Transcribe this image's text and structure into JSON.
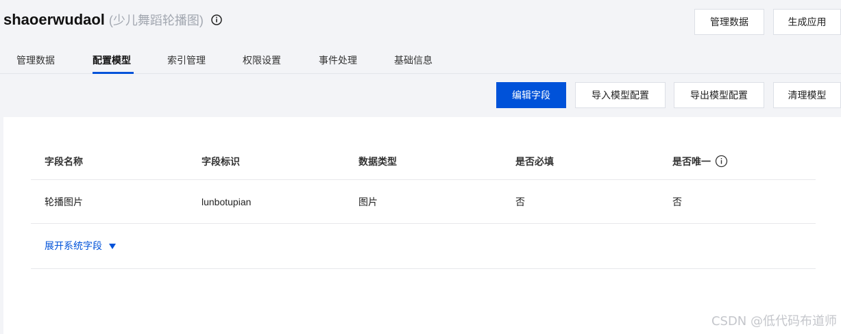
{
  "app": {
    "name": "shaoerwudaol",
    "description": "(少儿舞蹈轮播图)"
  },
  "header_buttons": {
    "manage_data": "管理数据",
    "generate_app": "生成应用"
  },
  "tabs": [
    {
      "label": "管理数据",
      "active": false
    },
    {
      "label": "配置模型",
      "active": true
    },
    {
      "label": "索引管理",
      "active": false
    },
    {
      "label": "权限设置",
      "active": false
    },
    {
      "label": "事件处理",
      "active": false
    },
    {
      "label": "基础信息",
      "active": false
    }
  ],
  "toolbar": {
    "edit_fields": "编辑字段",
    "import_config": "导入模型配置",
    "export_config": "导出模型配置",
    "clear_model": "清理模型"
  },
  "table": {
    "columns": [
      "字段名称",
      "字段标识",
      "数据类型",
      "是否必填",
      "是否唯一"
    ],
    "rows": [
      [
        "轮播图片",
        "lunbotupian",
        "图片",
        "否",
        "否"
      ]
    ]
  },
  "expand_system_fields": "展开系统字段",
  "watermark": "CSDN @低代码布道师",
  "colors": {
    "primary": "#0052d9",
    "background": "#f3f4f7",
    "panel": "#ffffff"
  }
}
